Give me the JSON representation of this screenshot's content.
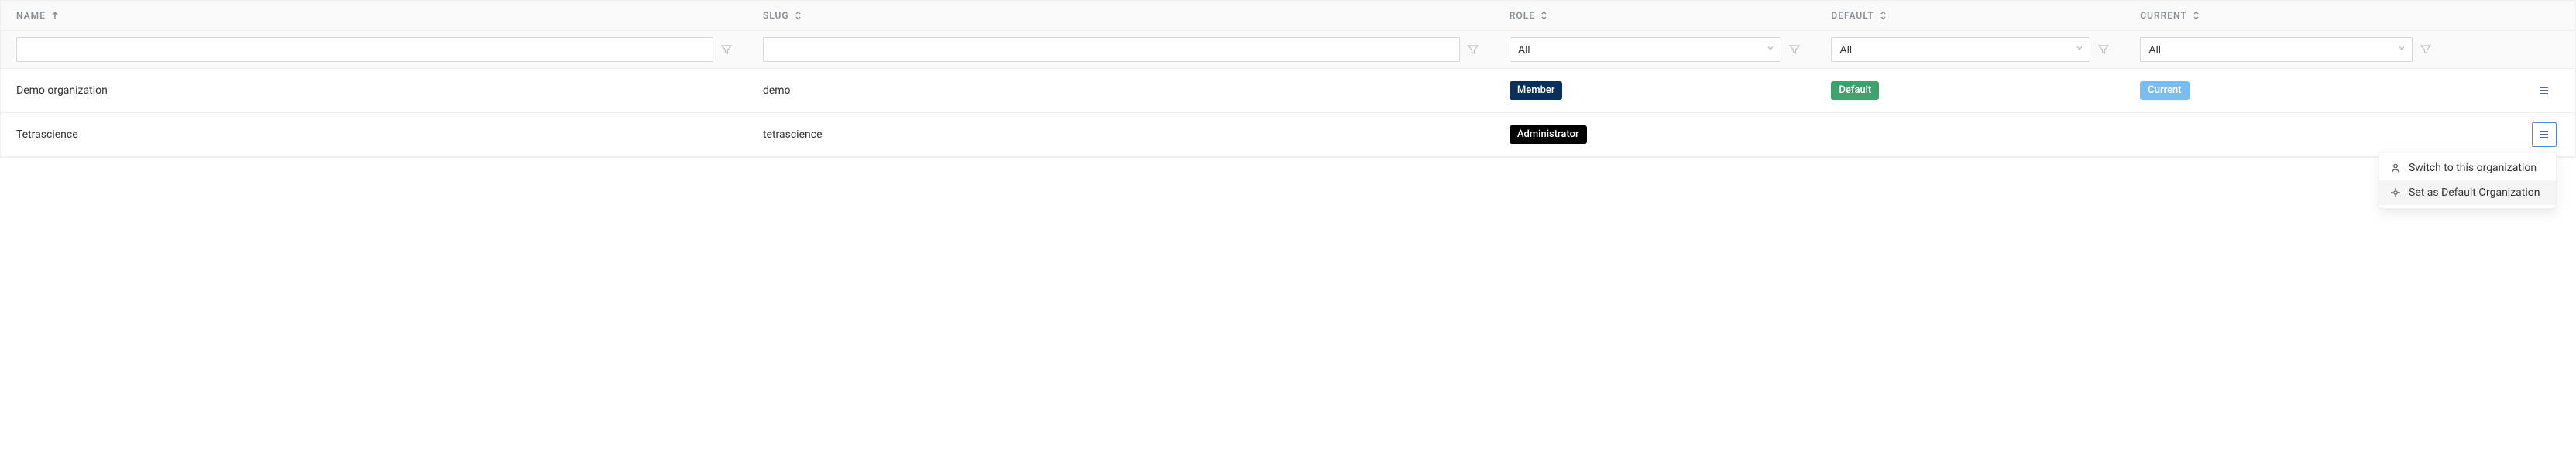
{
  "columns": {
    "name": {
      "label": "NAME",
      "sort": "asc"
    },
    "slug": {
      "label": "SLUG",
      "sort": "both"
    },
    "role": {
      "label": "ROLE",
      "sort": "both"
    },
    "default": {
      "label": "DEFAULT",
      "sort": "both"
    },
    "current": {
      "label": "CURRENT",
      "sort": "both"
    }
  },
  "filters": {
    "name_value": "",
    "slug_value": "",
    "role_select": "All",
    "default_select": "All",
    "current_select": "All"
  },
  "rows": [
    {
      "name": "Demo organization",
      "slug": "demo",
      "role": {
        "label": "Member",
        "variant": "member"
      },
      "default": {
        "label": "Default",
        "variant": "default"
      },
      "current": {
        "label": "Current",
        "variant": "current"
      },
      "menu_open": false
    },
    {
      "name": "Tetrascience",
      "slug": "tetrascience",
      "role": {
        "label": "Administrator",
        "variant": "admin"
      },
      "default": null,
      "current": null,
      "menu_open": true
    }
  ],
  "dropdown": {
    "items": [
      {
        "label": "Switch to this organization",
        "icon": "user"
      },
      {
        "label": "Set as Default Organization",
        "icon": "target",
        "highlight": true
      }
    ]
  }
}
